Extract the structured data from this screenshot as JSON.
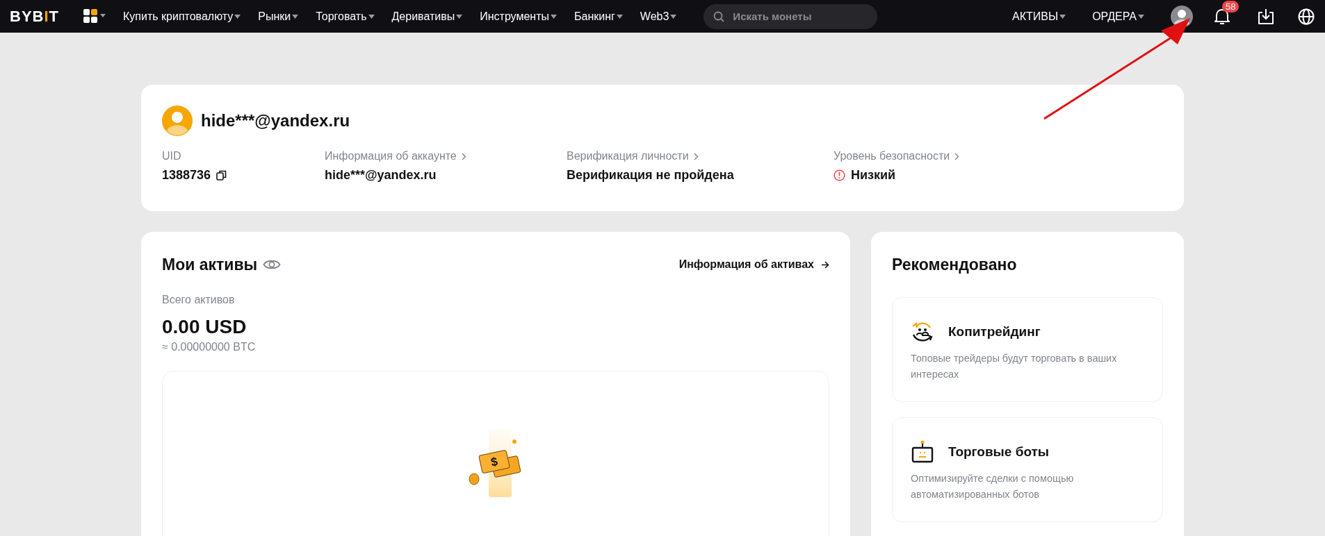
{
  "nav": {
    "logo": "BYBIT",
    "menu": [
      {
        "label": "Купить криптовалюту"
      },
      {
        "label": "Рынки"
      },
      {
        "label": "Торговать"
      },
      {
        "label": "Деривативы"
      },
      {
        "label": "Инструменты"
      },
      {
        "label": "Банкинг"
      },
      {
        "label": "Web3"
      }
    ],
    "search": {
      "placeholder": "Искать монеты"
    },
    "right_menu": [
      {
        "label": "АКТИВЫ"
      },
      {
        "label": "ОРДЕРА"
      }
    ],
    "notifications_badge": "58"
  },
  "profile": {
    "email": "hide***@yandex.ru",
    "fields": [
      {
        "kind": "uid",
        "label": "UID",
        "value": "1388736"
      },
      {
        "kind": "plain",
        "label": "Информация об аккаунте",
        "value": "hide***@yandex.ru"
      },
      {
        "kind": "plain",
        "label": "Верификация личности",
        "value": "Верификация не пройдена"
      },
      {
        "kind": "warning",
        "label": "Уровень безопасности",
        "value": "Низкий"
      }
    ]
  },
  "assets": {
    "title": "Мои активы",
    "link": "Информация об активах",
    "total_label": "Всего активов",
    "total": "0.00 USD",
    "btc": "≈ 0.00000000 BTC",
    "empty_symbol": "$"
  },
  "recommended": {
    "title": "Рекомендовано",
    "items": [
      {
        "kind": "copy_trading",
        "title": "Копитрейдинг",
        "description": "Топовые трейдеры будут торговать в ваших интересах"
      },
      {
        "kind": "bots",
        "title": "Торговые боты",
        "description": "Оптимизируйте сделки с помощью автоматизированных ботов"
      }
    ]
  }
}
